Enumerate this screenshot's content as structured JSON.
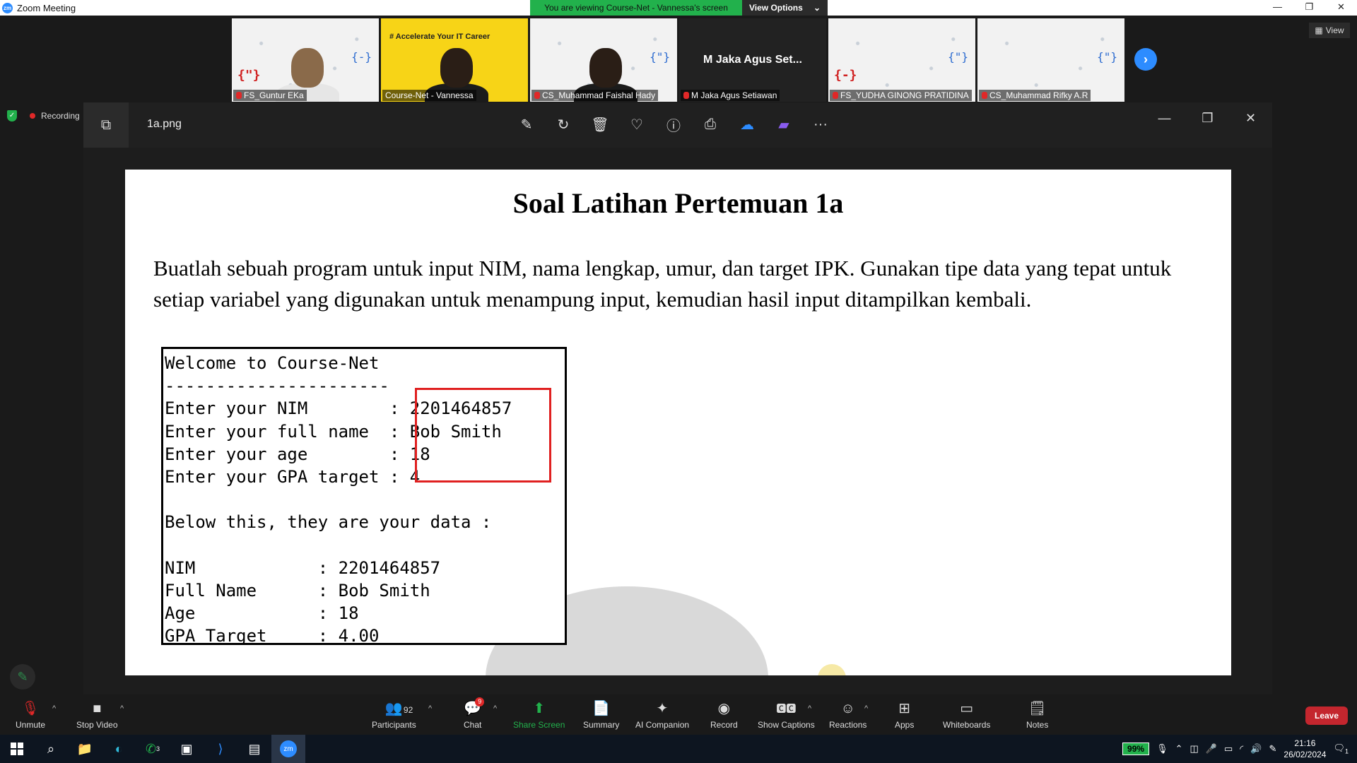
{
  "window": {
    "title": "Zoom Meeting",
    "logo_text": "zm",
    "controls": [
      "—",
      "❐",
      "✕"
    ]
  },
  "banner": {
    "viewing_text": "You are viewing Course-Net - Vannessa's screen",
    "options_label": "View Options",
    "options_caret": "⌄"
  },
  "gallery": {
    "participants": [
      {
        "name": "FS_Guntur EKa"
      },
      {
        "name": "Course-Net - Vannessa",
        "overlay": "# Accelerate Your IT Career"
      },
      {
        "name": "CS_Muhammad Faishal Hady"
      },
      {
        "name": "M Jaka Agus Setiawan",
        "display": "M Jaka Agus Set..."
      },
      {
        "name": "FS_YUDHA GINONG PRATIDINA"
      },
      {
        "name": "CS_Muhammad Rifky A.R"
      }
    ],
    "next_icon": "›",
    "view_label": "View"
  },
  "recording": {
    "label": "Recording"
  },
  "viewer": {
    "filename": "1a.png",
    "tool_icons": [
      "edit-image-icon",
      "rotate-icon",
      "delete-icon",
      "favorite-icon",
      "info-icon",
      "print-icon",
      "onedrive-icon",
      "clipchamp-icon",
      "more-icon"
    ],
    "tool_glyphs": [
      "✎",
      "↻",
      "🗑",
      "♡",
      "ⓘ",
      "⎙",
      "☁",
      "▰",
      "···"
    ],
    "window_controls": [
      "—",
      "❐",
      "✕"
    ]
  },
  "document": {
    "title": "Soal Latihan Pertemuan 1a",
    "paragraph": "Buatlah sebuah program untuk input NIM, nama lengkap, umur, dan target IPK. Gunakan tipe data yang tepat untuk setiap variabel yang digunakan untuk menampung input, kemudian hasil input ditampilkan kembali.",
    "console_lines": [
      "Welcome to Course-Net",
      "----------------------",
      "Enter your NIM        : 2201464857",
      "Enter your full name  : Bob Smith",
      "Enter your age        : 18",
      "Enter your GPA target : 4",
      "",
      "Below this, they are your data :",
      "",
      "NIM            : 2201464857",
      "Full Name      : Bob Smith",
      "Age            : 18",
      "GPA Target     : 4.00"
    ]
  },
  "toolbar": {
    "unmute": "Unmute",
    "stop_video": "Stop Video",
    "participants": "Participants",
    "participants_count": "92",
    "chat": "Chat",
    "chat_badge": "9",
    "share_screen": "Share Screen",
    "summary": "Summary",
    "ai_companion": "AI Companion",
    "record": "Record",
    "show_captions": "Show Captions",
    "reactions": "Reactions",
    "apps": "Apps",
    "whiteboards": "Whiteboards",
    "notes": "Notes",
    "leave": "Leave",
    "caret": "^"
  },
  "taskbar": {
    "battery": "99%",
    "time": "21:16",
    "date": "26/02/2024",
    "notification_count": "1",
    "whatsapp_badge": "3"
  },
  "colors": {
    "zoom_blue": "#2d8cff",
    "green": "#22b14c",
    "leave_red": "#c4262e",
    "highlight_red": "#e02020"
  }
}
